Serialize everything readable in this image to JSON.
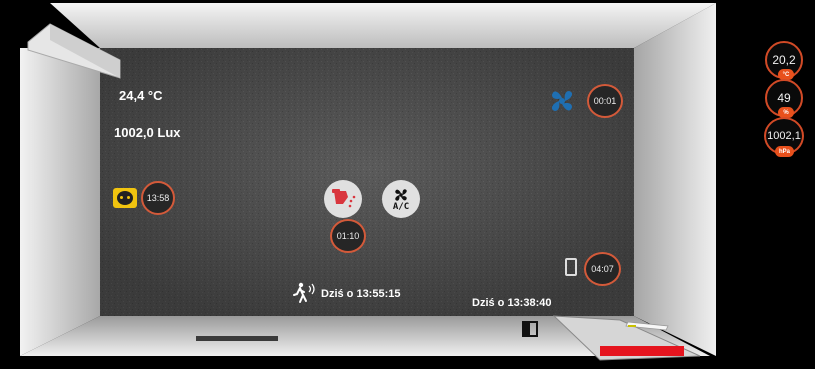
{
  "room": {
    "temperature": "24,4 °C",
    "illuminance": "1002,0 Lux"
  },
  "devices": {
    "socket_timer": "13:58",
    "fan_timer": "00:01",
    "heater_timer": "01:10",
    "tablet_timer": "04:07",
    "ac_label": "A/C"
  },
  "events": {
    "motion_time": "Dziś o 13:55:15",
    "door_time": "Dziś o 13:38:40"
  },
  "sensors": [
    {
      "value": "20,2",
      "unit": "°C"
    },
    {
      "value": "49",
      "unit": "%"
    },
    {
      "value": "1002,1",
      "unit": "hPa"
    }
  ],
  "colors": {
    "accent": "#e8501c",
    "fan_blue": "#1f6fb2",
    "socket_yellow": "#f1c40f",
    "heater_red": "#d9363e",
    "alarm_red": "#e5141e"
  }
}
